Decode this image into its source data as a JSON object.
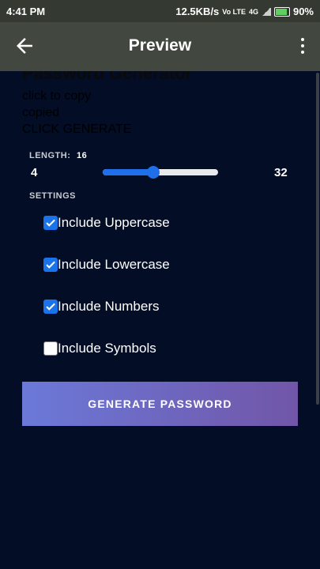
{
  "status_bar": {
    "time": "4:41 PM",
    "speed": "12.5KB/s",
    "volte": "Vo LTE",
    "network": "4G",
    "battery": "90%"
  },
  "app_bar": {
    "title": "Preview",
    "back_icon": "arrow-left-icon",
    "menu_icon": "more-vert-icon"
  },
  "content": {
    "title": "Password Generator",
    "click_to_copy": "click to copy",
    "copied": "copied",
    "click_generate": "CLICK GENERATE",
    "length_label": "LENGTH:",
    "length_value": "16",
    "min": "4",
    "max": "32",
    "slider_value": 16,
    "slider_min": 4,
    "slider_max": 32,
    "settings_label": "SETTINGS",
    "options": [
      {
        "label": "Include Uppercase",
        "checked": true
      },
      {
        "label": "Include Lowercase",
        "checked": true
      },
      {
        "label": "Include Numbers",
        "checked": true
      },
      {
        "label": "Include Symbols",
        "checked": false
      }
    ],
    "generate_button": "GENERATE PASSWORD"
  },
  "colors": {
    "background": "#040d26",
    "app_bar": "#424840",
    "accent": "#1a73e8",
    "button_start": "#6b79d8",
    "button_end": "#7156a8"
  }
}
